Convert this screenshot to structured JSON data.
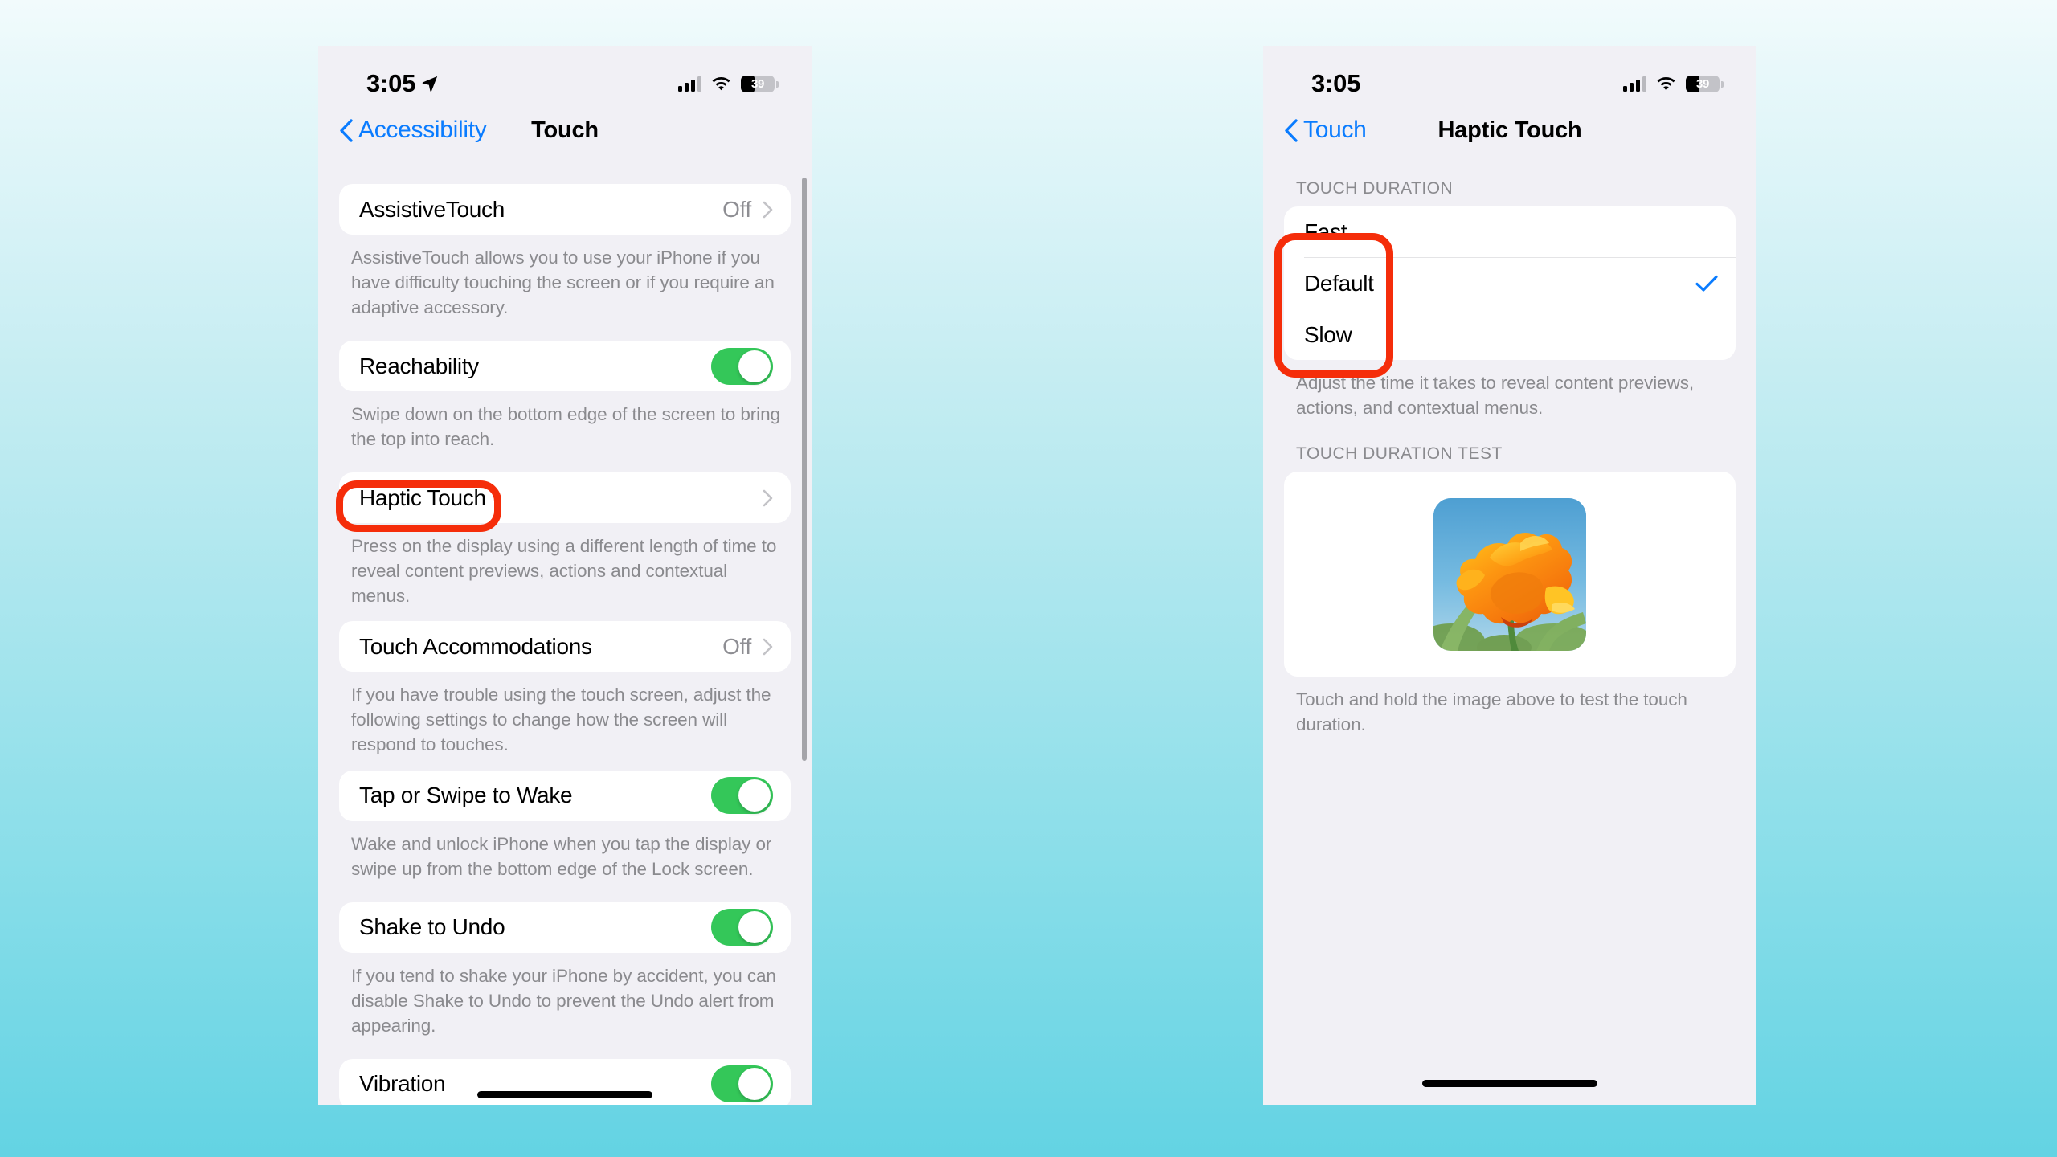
{
  "background": {
    "top_color": "#f2fbfc",
    "bottom_color": "#63d3e3"
  },
  "accent_color": "#0a7cff",
  "toggle_on_color": "#34c759",
  "annotation_color": "#f52d0a",
  "status_bar": {
    "time": "3:05",
    "location_icon": "location-arrow-icon",
    "cellular_icon": "cellular-bars-icon",
    "wifi_icon": "wifi-icon",
    "battery_icon": "battery-icon",
    "battery_percent": "39"
  },
  "left_screen": {
    "nav": {
      "back_label": "Accessibility",
      "back_icon": "chevron-left-icon",
      "title": "Touch"
    },
    "rows": [
      {
        "label": "AssistiveTouch",
        "value": "Off",
        "type": "disclosure",
        "footnote": "AssistiveTouch allows you to use your iPhone if you have difficulty touching the screen or if you require an adaptive accessory."
      },
      {
        "label": "Reachability",
        "value": "",
        "type": "toggle",
        "toggle_state": "on",
        "footnote": "Swipe down on the bottom edge of the screen to bring the top into reach."
      },
      {
        "label": "Haptic Touch",
        "value": "",
        "type": "disclosure",
        "highlighted": true,
        "footnote": "Press on the display using a different length of time to reveal content previews, actions and contextual menus."
      },
      {
        "label": "Touch Accommodations",
        "value": "Off",
        "type": "disclosure",
        "footnote": "If you have trouble using the touch screen, adjust the following settings to change how the screen will respond to touches."
      },
      {
        "label": "Tap or Swipe to Wake",
        "value": "",
        "type": "toggle",
        "toggle_state": "on",
        "footnote": "Wake and unlock iPhone when you tap the display or swipe up from the bottom edge of the Lock screen."
      },
      {
        "label": "Shake to Undo",
        "value": "",
        "type": "toggle",
        "toggle_state": "on",
        "footnote": "If you tend to shake your iPhone by accident, you can disable Shake to Undo to prevent the Undo alert from appearing."
      },
      {
        "label": "Vibration",
        "value": "",
        "type": "toggle",
        "toggle_state": "on",
        "footnote": ""
      }
    ]
  },
  "right_screen": {
    "nav": {
      "back_label": "Touch",
      "back_icon": "chevron-left-icon",
      "title": "Haptic Touch"
    },
    "section_touch_duration": {
      "header": "TOUCH DURATION",
      "options": [
        {
          "label": "Fast",
          "selected": false
        },
        {
          "label": "Default",
          "selected": true
        },
        {
          "label": "Slow",
          "selected": false
        }
      ],
      "check_icon": "checkmark-icon",
      "footnote": "Adjust the time it takes to reveal content previews, actions, and contextual menus."
    },
    "section_touch_duration_test": {
      "header": "TOUCH DURATION TEST",
      "image_name": "poppy-flower-image",
      "footnote": "Touch and hold the image above to test the touch duration."
    },
    "home_indicator": "home-indicator"
  }
}
